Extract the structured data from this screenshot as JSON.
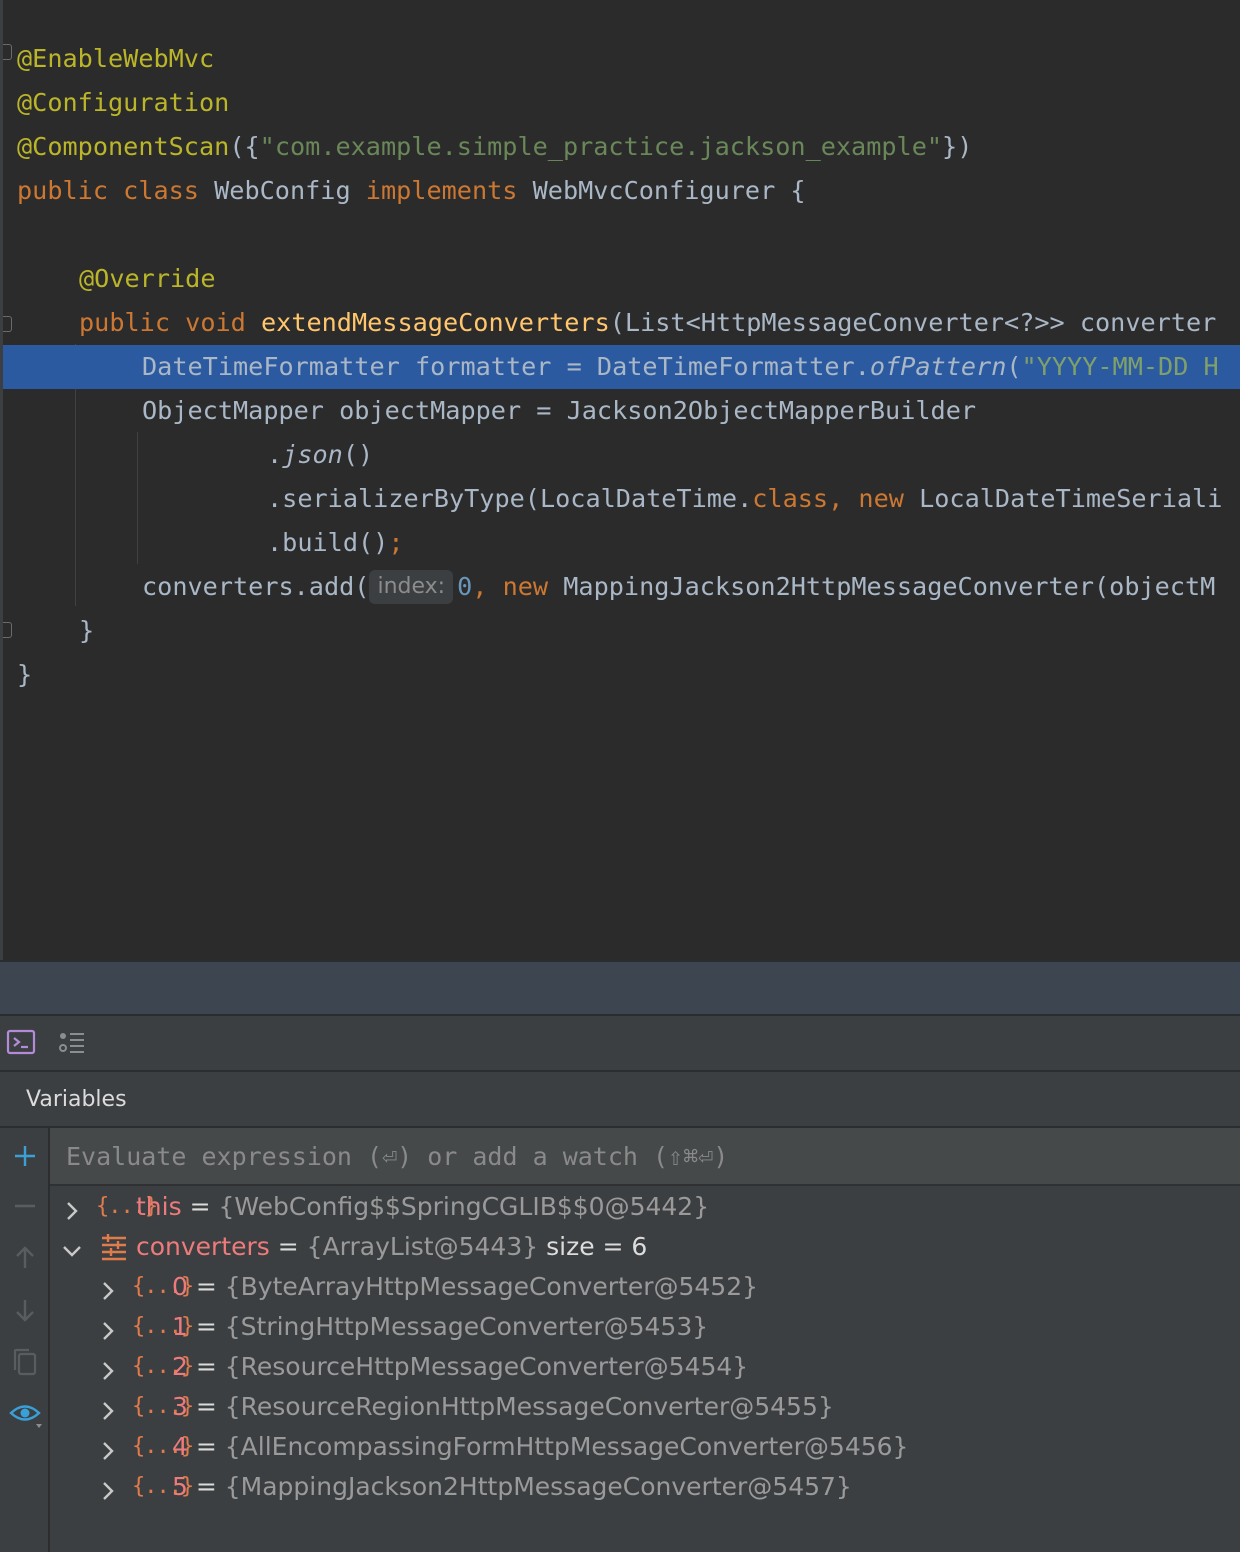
{
  "editor": {
    "lines": {
      "l1": {
        "a": "@EnableWebMvc"
      },
      "l2": {
        "a": "@Configuration"
      },
      "l3": {
        "a": "@ComponentScan",
        "b": "({",
        "c": "\"com.example.simple_practice.jackson_example\"",
        "d": "})"
      },
      "l4": {
        "a": "public class ",
        "b": "WebConfig ",
        "c": "implements ",
        "d": "WebMvcConfigurer {"
      },
      "l6": {
        "a": "@Override"
      },
      "l7": {
        "a": "public void ",
        "b": "extendMessageConverters",
        "c": "(List<HttpMessageConverter<?>> converter"
      },
      "l8": {
        "a": "DateTimeFormatter formatter = DateTimeFormatter.",
        "b": "ofPattern",
        "c": "(",
        "d": "\"YYYY-MM-DD H"
      },
      "l9": {
        "a": "ObjectMapper objectMapper = Jackson2ObjectMapperBuilder"
      },
      "l10": {
        "a": ".",
        "b": "json",
        "c": "()"
      },
      "l11": {
        "a": ".serializerByType(LocalDateTime.",
        "b": "class, new ",
        "c": "LocalDateTimeSeriali"
      },
      "l12": {
        "a": ".build()",
        "b": ";"
      },
      "l13": {
        "a": "converters.add(",
        "hint": "index:",
        "b": "0",
        "c": ", ",
        "d": "new ",
        "e": "MappingJackson2HttpMessageConverter(objectM"
      },
      "l14": {
        "a": "}"
      },
      "l15": {
        "a": "}"
      }
    }
  },
  "debug": {
    "toolbar": {
      "console_icon": "console-icon",
      "threads_icon": "threads-list-icon"
    },
    "variables_title": "Variables",
    "eval_placeholder": "Evaluate expression (⏎) or add a watch (⇧⌘⏎)",
    "side_icons": [
      "add-icon",
      "remove-icon",
      "arrow-up-icon",
      "arrow-down-icon",
      "copy-icon",
      "watch-eye-icon"
    ],
    "variables": [
      {
        "icon": "{...}",
        "name": "this",
        "eq": " = ",
        "value": "{WebConfig$$SpringCGLIB$$0@5442}",
        "extra": ""
      },
      {
        "icon": "list",
        "name": "converters",
        "eq": " = ",
        "value": "{ArrayList@5443}",
        "extra": "  size = 6"
      },
      {
        "icon": "{...}",
        "name": "0",
        "eq": " = ",
        "value": "{ByteArrayHttpMessageConverter@5452}",
        "extra": ""
      },
      {
        "icon": "{...}",
        "name": "1",
        "eq": " = ",
        "value": "{StringHttpMessageConverter@5453}",
        "extra": ""
      },
      {
        "icon": "{...}",
        "name": "2",
        "eq": " = ",
        "value": "{ResourceHttpMessageConverter@5454}",
        "extra": ""
      },
      {
        "icon": "{...}",
        "name": "3",
        "eq": " = ",
        "value": "{ResourceRegionHttpMessageConverter@5455}",
        "extra": ""
      },
      {
        "icon": "{...}",
        "name": "4",
        "eq": " = ",
        "value": "{AllEncompassingFormHttpMessageConverter@5456}",
        "extra": ""
      },
      {
        "icon": "{...}",
        "name": "5",
        "eq": " = ",
        "value": "{MappingJackson2HttpMessageConverter@5457}",
        "extra": ""
      }
    ],
    "colors": {
      "variable_name": "#ee7b7b",
      "object_icon": "#e07b4c",
      "accent_blue": "#3aa0d8"
    }
  }
}
